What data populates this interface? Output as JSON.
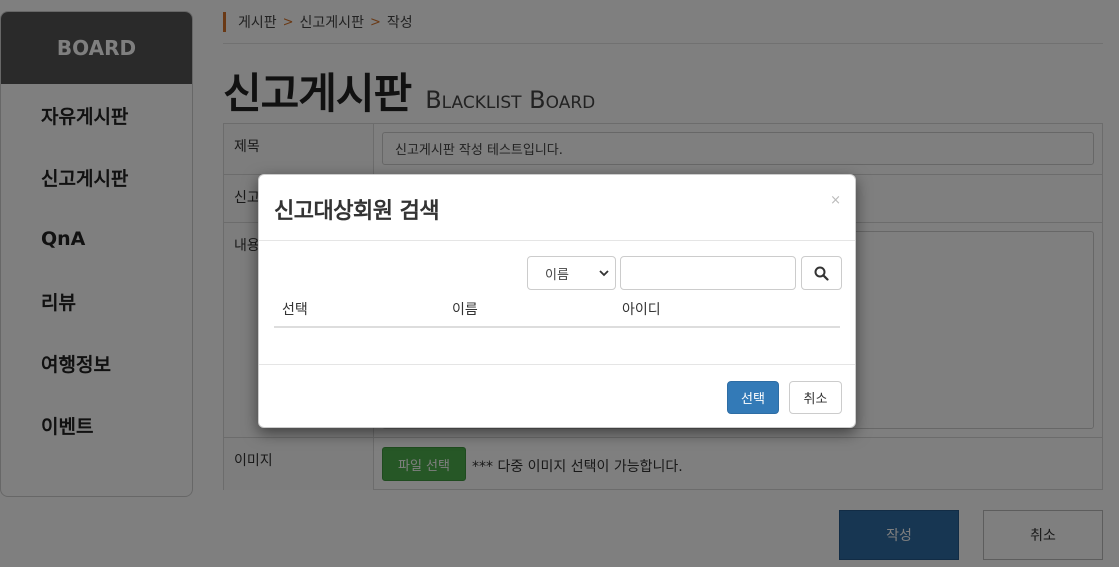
{
  "sidebar": {
    "title": "BOARD",
    "items": [
      {
        "label": "자유게시판"
      },
      {
        "label": "신고게시판"
      },
      {
        "label": "QnA"
      },
      {
        "label": "리뷰"
      },
      {
        "label": "여행정보"
      },
      {
        "label": "이벤트"
      }
    ]
  },
  "breadcrumb": [
    "게시판",
    "신고게시판",
    "작성"
  ],
  "breadcrumb_separator": ">",
  "page_title": {
    "korean": "신고게시판",
    "english": "Blacklist Board"
  },
  "form": {
    "title_label": "제목",
    "title_value": "신고게시판 작성 테스트입니다.",
    "target_label": "신고",
    "content_label": "내용",
    "image_label": "이미지",
    "file_button": "파일 선택",
    "file_note": "*** 다중 이미지 선택이 가능합니다."
  },
  "actions": {
    "submit": "작성",
    "cancel": "취소"
  },
  "modal": {
    "title": "신고대상회원 검색",
    "close": "×",
    "search_option": "이름",
    "search_value": "",
    "columns": [
      "선택",
      "이름",
      "아이디"
    ],
    "rows": [],
    "select_button": "선택",
    "cancel_button": "취소"
  },
  "colors": {
    "accent": "#d4722a",
    "primary": "#337ab7",
    "success": "#4cae4c",
    "sidebar_head": "#555555"
  }
}
